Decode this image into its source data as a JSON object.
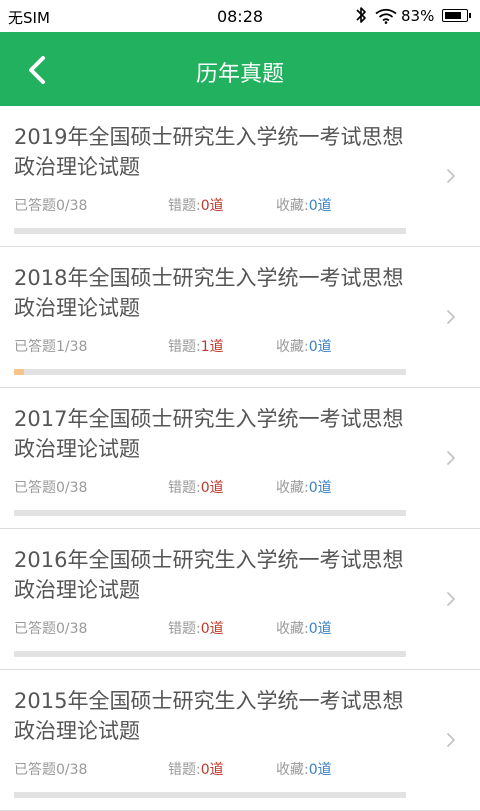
{
  "statusbar": {
    "carrier": "无SIM",
    "time": "08:28",
    "battery_pct": "83%",
    "battery_level": 0.83,
    "icons": [
      "bluetooth-icon",
      "wifi-icon",
      "battery-icon"
    ]
  },
  "header": {
    "title": "历年真题",
    "back_icon": "chevron-left-icon",
    "color": "#22b25f"
  },
  "colors": {
    "wrong_count": "#c0392b",
    "fav_count": "#3b82c4",
    "progress_fill": "#f7c48a",
    "progress_track": "#e2e2e2"
  },
  "exams": [
    {
      "title": "2019年全国硕士研究生入学统一考试思想政治理论试题",
      "answered_label": "已答题",
      "answered": "0/38",
      "progress": 0.0,
      "wrong_label": "错题:",
      "wrong": "0道",
      "fav_label": "收藏:",
      "fav": "0道"
    },
    {
      "title": "2018年全国硕士研究生入学统一考试思想政治理论试题",
      "answered_label": "已答题",
      "answered": "1/38",
      "progress": 0.026,
      "wrong_label": "错题:",
      "wrong": "1道",
      "fav_label": "收藏:",
      "fav": "0道"
    },
    {
      "title": "2017年全国硕士研究生入学统一考试思想政治理论试题",
      "answered_label": "已答题",
      "answered": "0/38",
      "progress": 0.0,
      "wrong_label": "错题:",
      "wrong": "0道",
      "fav_label": "收藏:",
      "fav": "0道"
    },
    {
      "title": "2016年全国硕士研究生入学统一考试思想政治理论试题",
      "answered_label": "已答题",
      "answered": "0/38",
      "progress": 0.0,
      "wrong_label": "错题:",
      "wrong": "0道",
      "fav_label": "收藏:",
      "fav": "0道"
    },
    {
      "title": "2015年全国硕士研究生入学统一考试思想政治理论试题",
      "answered_label": "已答题",
      "answered": "0/38",
      "progress": 0.0,
      "wrong_label": "错题:",
      "wrong": "0道",
      "fav_label": "收藏:",
      "fav": "0道"
    }
  ]
}
